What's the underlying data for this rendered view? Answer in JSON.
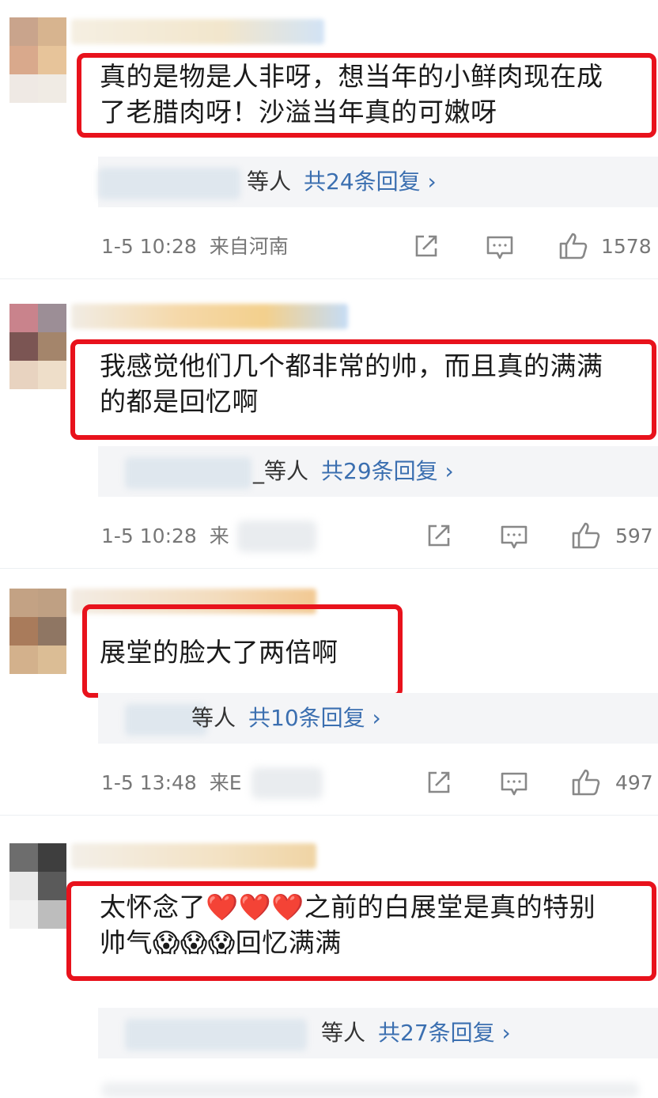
{
  "comments": [
    {
      "text_line1": "真的是物是人非呀，想当年的小鲜肉现在成",
      "text_line2": "了老腊肉呀！沙溢当年真的可嫩呀",
      "reply_who": "等人",
      "reply_count": "共24条回复 ›",
      "time": "1-5 10:28",
      "location": "来自河南",
      "likes": "1578"
    },
    {
      "text_line1": "我感觉他们几个都非常的帅，而且真的满满",
      "text_line2": "的都是回忆啊",
      "reply_who": "_等人",
      "reply_count": "共29条回复 ›",
      "time": "1-5 10:28",
      "location": "来",
      "likes": "597"
    },
    {
      "text_line1": "展堂的脸大了两倍啊",
      "reply_who": "等人",
      "reply_count": "共10条回复 ›",
      "time": "1-5 13:48",
      "location": "来E",
      "likes": "497"
    },
    {
      "text_line1": "太怀念了❤️❤️❤️之前的白展堂是真的特别",
      "text_line2": "帅气😱😱😱回忆满满",
      "reply_who": "等人",
      "reply_count": "共27条回复 ›",
      "time": "",
      "location": "",
      "likes": ""
    }
  ],
  "colors": {
    "highlight": "#e8121c",
    "link": "#3b6fb0",
    "meta": "#777777",
    "reply_bg": "#f4f5f7"
  },
  "icons": [
    "share-icon",
    "comment-icon",
    "like-icon"
  ]
}
